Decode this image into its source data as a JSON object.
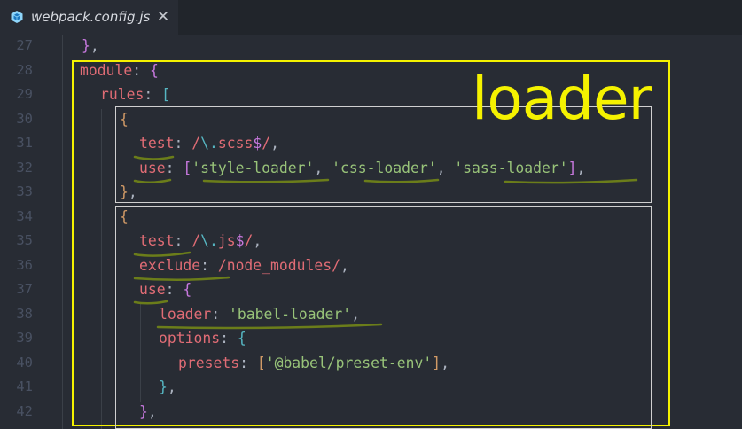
{
  "tab": {
    "title": "webpack.config.js",
    "close_glyph": "✕",
    "icon": "webpack-cube-icon"
  },
  "line_numbers": [
    "27",
    "28",
    "29",
    "30",
    "31",
    "32",
    "33",
    "34",
    "35",
    "36",
    "37",
    "38",
    "39",
    "40",
    "41",
    "42"
  ],
  "annotation": {
    "label": "loader",
    "highlight_color": "#f5f200",
    "underline_color": "#6b7d1a"
  },
  "code": {
    "l27": {
      "t1": "}",
      "t2": ","
    },
    "l28": {
      "t1": "module",
      "t2": ": ",
      "t3": "{"
    },
    "l29": {
      "t1": "rules",
      "t2": ": ",
      "t3": "["
    },
    "l30": {
      "t1": "{"
    },
    "l31": {
      "t1": "test",
      "t2": ": ",
      "t3": "/",
      "t4": "\\.",
      "t5": "scss",
      "t6": "$",
      "t7": "/",
      "t8": ","
    },
    "l32": {
      "t1": "use",
      "t2": ": ",
      "t3": "[",
      "t4": "'style-loader'",
      "t5": ", ",
      "t6": "'css-loader'",
      "t7": ", ",
      "t8": "'sass-loader'",
      "t9": "]",
      "t10": ","
    },
    "l33": {
      "t1": "}",
      "t2": ","
    },
    "l34": {
      "t1": "{"
    },
    "l35": {
      "t1": "test",
      "t2": ": ",
      "t3": "/",
      "t4": "\\.",
      "t5": "js",
      "t6": "$",
      "t7": "/",
      "t8": ","
    },
    "l36": {
      "t1": "exclude",
      "t2": ": ",
      "t3": "/node_modules/",
      "t4": ","
    },
    "l37": {
      "t1": "use",
      "t2": ": ",
      "t3": "{"
    },
    "l38": {
      "t1": "loader",
      "t2": ": ",
      "t3": "'babel-loader'",
      "t4": ","
    },
    "l39": {
      "t1": "options",
      "t2": ": ",
      "t3": "{"
    },
    "l40": {
      "t1": "presets",
      "t2": ": ",
      "t3": "[",
      "t4": "'@babel/preset-env'",
      "t5": "]",
      "t6": ","
    },
    "l41": {
      "t1": "}",
      "t2": ","
    },
    "l42": {
      "t1": "}",
      "t2": ","
    }
  }
}
